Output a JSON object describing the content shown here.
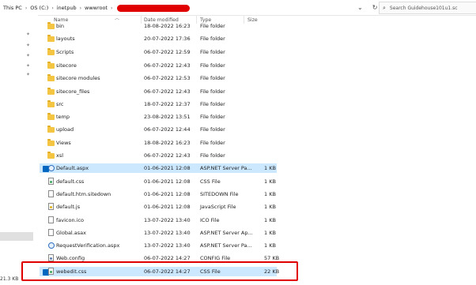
{
  "breadcrumb": {
    "parts": [
      "This PC",
      "OS (C:)",
      "inetpub",
      "wwwroot"
    ],
    "separator": "›"
  },
  "search": {
    "placeholder": "Search Guidehouse101u1.sc"
  },
  "columns": {
    "name": "Name",
    "date": "Date modified",
    "type": "Type",
    "size": "Size"
  },
  "rows": [
    {
      "name": "bin",
      "date": "18-08-2022 16:23",
      "type": "File folder",
      "size": "",
      "icon": "folder-icon"
    },
    {
      "name": "layouts",
      "date": "20-07-2022 17:36",
      "type": "File folder",
      "size": "",
      "icon": "folder-icon"
    },
    {
      "name": "Scripts",
      "date": "06-07-2022 12:59",
      "type": "File folder",
      "size": "",
      "icon": "folder-icon"
    },
    {
      "name": "sitecore",
      "date": "06-07-2022 12:43",
      "type": "File folder",
      "size": "",
      "icon": "folder-icon"
    },
    {
      "name": "sitecore modules",
      "date": "06-07-2022 12:53",
      "type": "File folder",
      "size": "",
      "icon": "folder-icon"
    },
    {
      "name": "sitecore_files",
      "date": "06-07-2022 12:43",
      "type": "File folder",
      "size": "",
      "icon": "folder-icon"
    },
    {
      "name": "src",
      "date": "18-07-2022 12:37",
      "type": "File folder",
      "size": "",
      "icon": "folder-icon"
    },
    {
      "name": "temp",
      "date": "23-08-2022 13:51",
      "type": "File folder",
      "size": "",
      "icon": "folder-icon"
    },
    {
      "name": "upload",
      "date": "06-07-2022 12:44",
      "type": "File folder",
      "size": "",
      "icon": "folder-icon"
    },
    {
      "name": "Views",
      "date": "18-08-2022 16:23",
      "type": "File folder",
      "size": "",
      "icon": "folder-icon"
    },
    {
      "name": "xsl",
      "date": "06-07-2022 12:43",
      "type": "File folder",
      "size": "",
      "icon": "folder-icon"
    },
    {
      "name": "Default.aspx",
      "date": "01-06-2021 12:08",
      "type": "ASP.NET Server Pa...",
      "size": "1 KB",
      "icon": "aspx-globe-icon"
    },
    {
      "name": "default.css",
      "date": "01-06-2021 12:08",
      "type": "CSS File",
      "size": "1 KB",
      "icon": "css-file-icon"
    },
    {
      "name": "default.htm.sitedown",
      "date": "01-06-2021 12:08",
      "type": "SITEDOWN File",
      "size": "1 KB",
      "icon": "file-icon"
    },
    {
      "name": "default.js",
      "date": "01-06-2021 12:08",
      "type": "JavaScript File",
      "size": "1 KB",
      "icon": "js-file-icon"
    },
    {
      "name": "favicon.ico",
      "date": "13-07-2022 13:40",
      "type": "ICO File",
      "size": "1 KB",
      "icon": "file-icon"
    },
    {
      "name": "Global.asax",
      "date": "13-07-2022 13:40",
      "type": "ASP.NET Server Ap...",
      "size": "1 KB",
      "icon": "file-icon"
    },
    {
      "name": "RequestVerification.aspx",
      "date": "13-07-2022 13:40",
      "type": "ASP.NET Server Pa...",
      "size": "1 KB",
      "icon": "aspx-globe-icon"
    },
    {
      "name": "Web.config",
      "date": "06-07-2022 14:27",
      "type": "CONFIG File",
      "size": "57 KB",
      "icon": "config-file-icon"
    },
    {
      "name": "webedit.css",
      "date": "06-07-2022 14:27",
      "type": "CSS File",
      "size": "22 KB",
      "icon": "css-file-icon"
    }
  ],
  "status": {
    "text": "21.3 KB"
  },
  "colors": {
    "selection": "#cce8ff",
    "highlight_box": "#e00000",
    "redaction": "#e10000"
  }
}
